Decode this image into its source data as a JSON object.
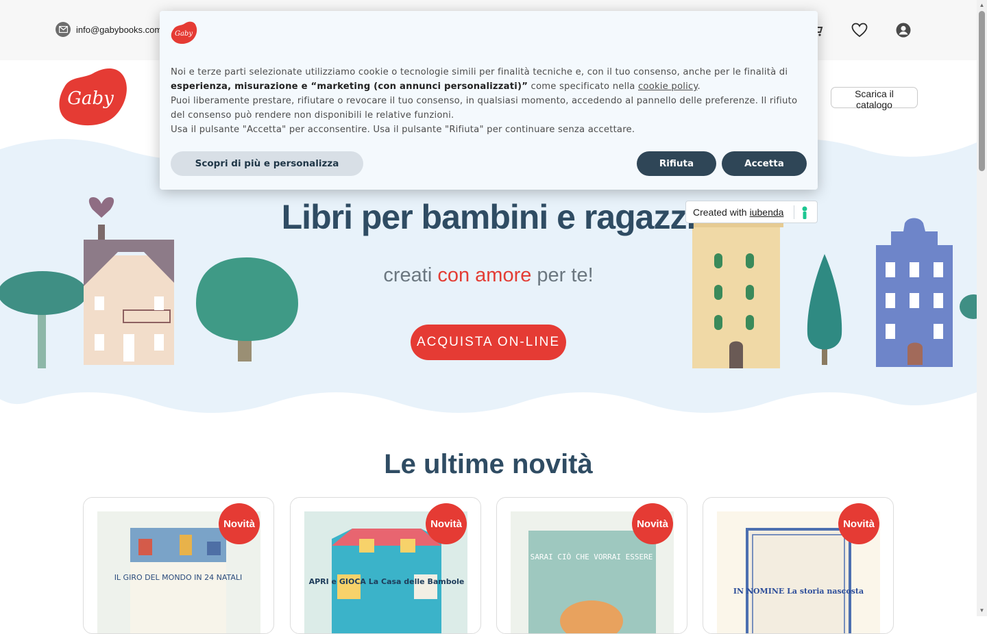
{
  "topbar": {
    "email": "info@gabybooks.com",
    "icons": [
      "mail-icon",
      "cart-icon",
      "heart-icon",
      "user-icon"
    ]
  },
  "header": {
    "logo_text": "Gaby",
    "catalog_button": "Scarica il catalogo"
  },
  "hero": {
    "title": "Libri per bambini e ragazzi",
    "subtitle_pre": "creati ",
    "subtitle_accent": "con amore",
    "subtitle_post": " per te!",
    "cta": "ACQUISTA ON-LINE"
  },
  "section": {
    "title": "Le ultime novità",
    "badge": "Novità",
    "books": [
      {
        "cover_title": "IL GIRO DEL MONDO IN 24 NATALI"
      },
      {
        "cover_title": "APRI e GIOCA La Casa delle Bambole"
      },
      {
        "cover_title": "SARAI CIÒ CHE VORRAI ESSERE"
      },
      {
        "cover_title": "IN NOMINE La storia nascosta"
      }
    ]
  },
  "cookie": {
    "p1_a": "Noi e terze parti selezionate utilizziamo cookie o tecnologie simili per finalità tecniche e, con il tuo consenso, anche per le finalità di ",
    "p1_b": "esperienza, misurazione e “marketing (con annunci personalizzati)”",
    "p1_c": " come specificato nella ",
    "p1_link": "cookie policy",
    "p1_d": ".",
    "p2": "Puoi liberamente prestare, rifiutare o revocare il tuo consenso, in qualsiasi momento, accedendo al pannello delle preferenze. Il rifiuto del consenso può rendere non disponibili le relative funzioni.",
    "p3": "Usa il pulsante \"Accetta\" per acconsentire. Usa il pulsante \"Rifiuta\" per continuare senza accettare.",
    "btn_more": "Scopri di più e personalizza",
    "btn_reject": "Rifiuta",
    "btn_accept": "Accetta"
  },
  "iubenda": {
    "created": "Created with",
    "brand": "iubenda"
  },
  "colors": {
    "accent": "#e53b34",
    "title": "#2f4c63",
    "sky": "#e8f2fa",
    "dark_button": "#2f4657"
  }
}
